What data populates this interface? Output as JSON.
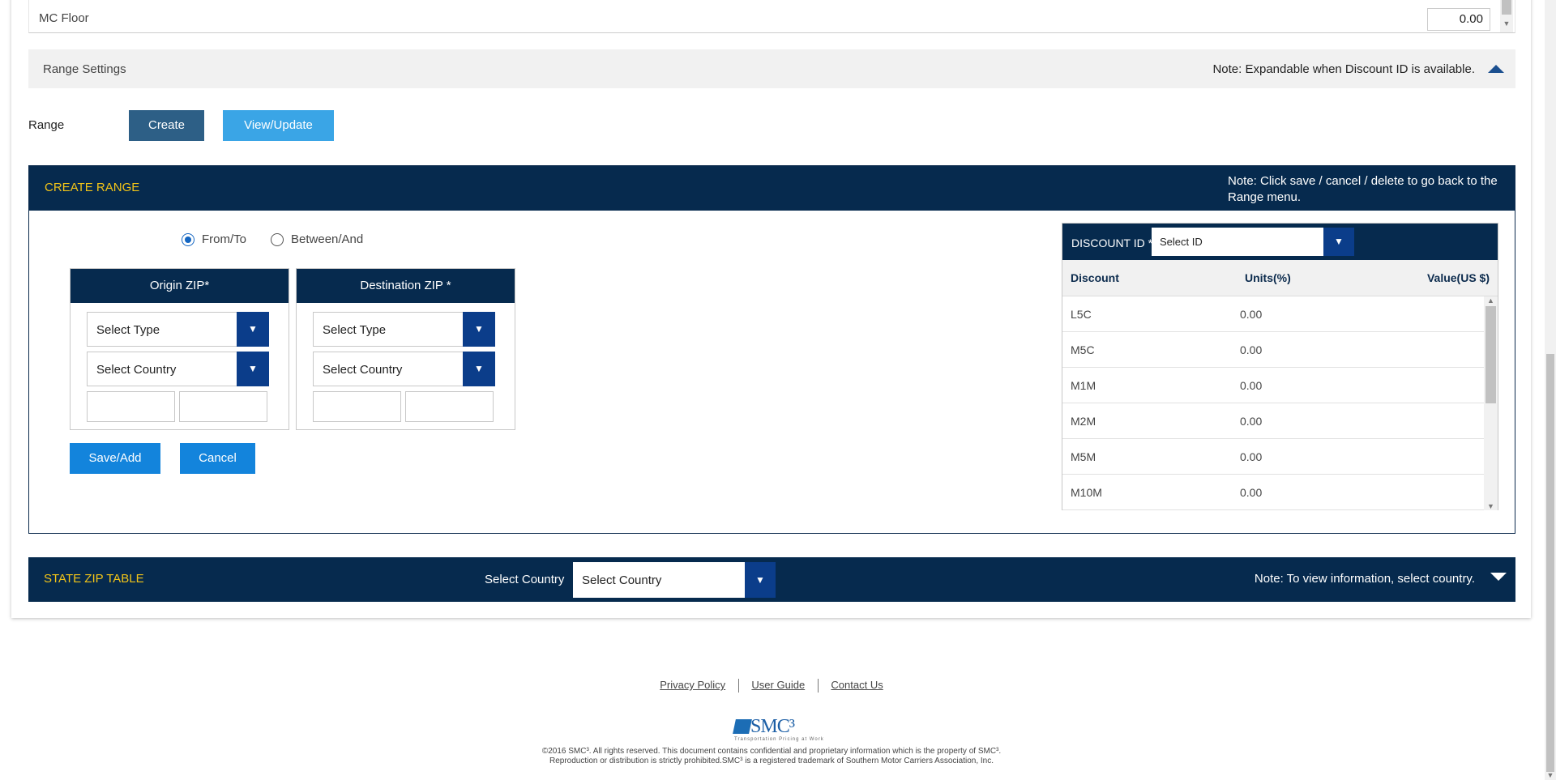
{
  "mc_floor": {
    "label": "MC Floor",
    "value": "0.00"
  },
  "range_settings": {
    "title": "Range Settings",
    "note": "Note: Expandable when Discount ID is available."
  },
  "range": {
    "label": "Range",
    "create_label": "Create",
    "view_update_label": "View/Update"
  },
  "create_range": {
    "title": "CREATE RANGE",
    "note": "Note: Click save / cancel / delete to go back to the Range menu.",
    "radio_from_to": "From/To",
    "radio_between_and": "Between/And",
    "origin": {
      "title": "Origin ZIP*",
      "type_value": "Select Type",
      "country_value": "Select Country",
      "from_value": "",
      "to_value": ""
    },
    "destination": {
      "title": "Destination ZIP *",
      "type_value": "Select Type",
      "country_value": "Select Country",
      "from_value": "",
      "to_value": ""
    },
    "save_label": "Save/Add",
    "cancel_label": "Cancel"
  },
  "discount": {
    "id_label": "DISCOUNT ID *",
    "id_value": "Select ID",
    "columns": [
      "Discount",
      "Units(%)",
      "Value(US $)"
    ],
    "rows": [
      {
        "code": "L5C",
        "units": "0.00",
        "value": ""
      },
      {
        "code": "M5C",
        "units": "0.00",
        "value": ""
      },
      {
        "code": "M1M",
        "units": "0.00",
        "value": ""
      },
      {
        "code": "M2M",
        "units": "0.00",
        "value": ""
      },
      {
        "code": "M5M",
        "units": "0.00",
        "value": ""
      },
      {
        "code": "M10M",
        "units": "0.00",
        "value": ""
      }
    ]
  },
  "state_zip": {
    "title": "STATE ZIP TABLE",
    "select_label": "Select Country",
    "select_value": "Select Country",
    "note": "Note: To view information, select country."
  },
  "footer": {
    "links": [
      "Privacy Policy",
      "User Guide",
      "Contact Us"
    ],
    "logo_text": "SMC³",
    "logo_tagline": "Transportation Pricing at Work",
    "copyright_line1": "©2016 SMC³. All rights reserved. This document contains confidential and proprietary information which is the property of SMC³.",
    "copyright_line2": "Reproduction or distribution is strictly prohibited.SMC³ is a registered trademark of Southern Motor Carriers Association, Inc."
  },
  "colors": {
    "navy": "#062a4e",
    "gold": "#f2c418",
    "blue_button": "#1384dc",
    "dropdown": "#0b3d8a"
  },
  "icons": {
    "dropdown": "triangle-down-icon",
    "collapse": "triangle-up-icon",
    "expand": "triangle-down-icon"
  }
}
